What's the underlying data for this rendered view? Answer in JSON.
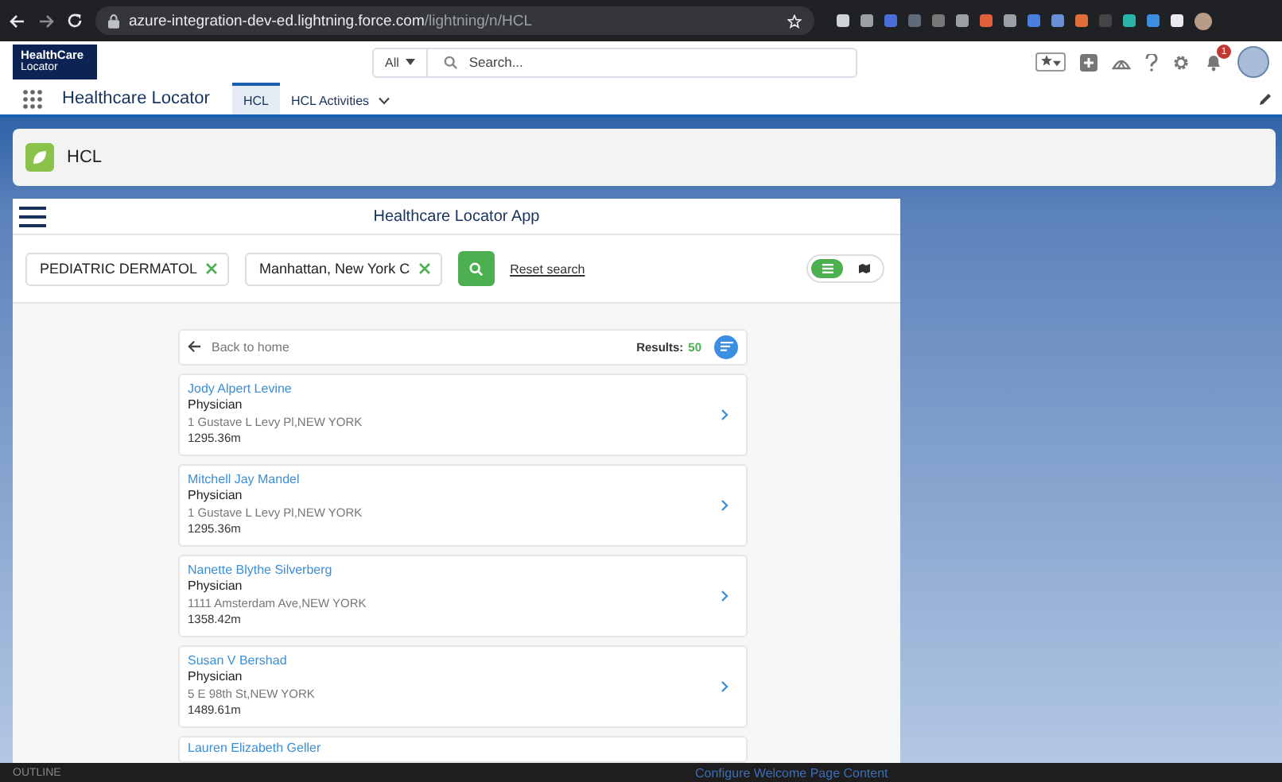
{
  "browser": {
    "url_host": "azure-integration-dev-ed.lightning.force.com",
    "url_path": "/lightning/n/HCL"
  },
  "header": {
    "logo_lines": [
      "HealthCare",
      "Locator"
    ],
    "search_scope": "All",
    "search": {
      "placeholder": "Search..."
    },
    "notification_count": "1"
  },
  "nav": {
    "app_name": "Healthcare Locator",
    "tabs": [
      {
        "label": "HCL",
        "selected": true,
        "dropdown": false
      },
      {
        "label": "HCL Activities",
        "selected": false,
        "dropdown": true
      }
    ]
  },
  "page_header": {
    "title": "HCL"
  },
  "app": {
    "title": "Healthcare Locator App",
    "filters": [
      {
        "value": "PEDIATRIC DERMATOL"
      },
      {
        "value": "Manhattan, New York C"
      }
    ],
    "reset": "Reset search",
    "views": [
      {
        "kind": "list",
        "selected": true
      },
      {
        "kind": "map",
        "selected": false
      }
    ],
    "back": "Back to home",
    "results_label": "Results:",
    "results_count": "50",
    "results": [
      {
        "name": "Jody Alpert Levine",
        "role": "Physician",
        "address": "1 Gustave L Levy Pl,NEW YORK",
        "distance": "1295.36m"
      },
      {
        "name": "Mitchell Jay Mandel",
        "role": "Physician",
        "address": "1 Gustave L Levy Pl,NEW YORK",
        "distance": "1295.36m"
      },
      {
        "name": "Nanette Blythe Silverberg",
        "role": "Physician",
        "address": "1111 Amsterdam Ave,NEW YORK",
        "distance": "1358.42m"
      },
      {
        "name": "Susan V Bershad",
        "role": "Physician",
        "address": "5 E 98th St,NEW YORK",
        "distance": "1489.61m"
      },
      {
        "name": "Lauren Elizabeth Geller"
      }
    ]
  },
  "bottom_bar": {
    "left": "OUTLINE",
    "center": "Configure Welcome Page Content"
  }
}
